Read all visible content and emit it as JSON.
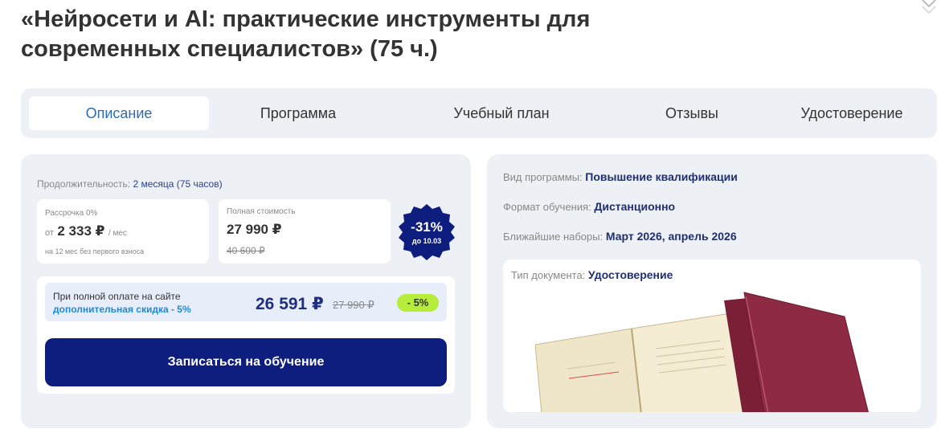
{
  "header": {
    "title_line1": "«Нейросети и AI: практические инструменты для",
    "title_line2": "современных специалистов» (75 ч.)"
  },
  "tabs": [
    {
      "label": "Описание",
      "active": true
    },
    {
      "label": "Программа",
      "active": false
    },
    {
      "label": "Учебный план",
      "active": false
    },
    {
      "label": "Отзывы",
      "active": false
    },
    {
      "label": "Удостоверение",
      "active": false
    }
  ],
  "pricing": {
    "duration_label": "Продолжительность:",
    "duration_value": "2 месяца (75 часов)",
    "installment": {
      "title": "Рассрочка 0%",
      "prefix": "от",
      "amount": "2 333 ₽",
      "suffix": "/ мес",
      "note": "на 12 мес без первого взноса"
    },
    "full_price": {
      "title": "Полная стоимость",
      "price": "27 990 ₽",
      "old_price": "40 600 ₽"
    },
    "discount_badge": {
      "percent": "-31%",
      "until": "до 10.03"
    },
    "promo": {
      "line1": "При полной оплате на сайте",
      "line2": "дополнительная скидка - 5%",
      "price": "26 591 ₽",
      "old_price": "27 990 ₽",
      "pill": "- 5%"
    },
    "cta_label": "Записаться на обучение"
  },
  "details": {
    "program_type_label": "Вид программы:",
    "program_type_value": "Повышение квалификации",
    "format_label": "Формат обучения:",
    "format_value": "Дистанционно",
    "enrollment_label": "Ближайшие наборы:",
    "enrollment_value": "Март 2026, апрель 2026",
    "document_label": "Тип документа:",
    "document_value": "Удостоверение"
  },
  "colors": {
    "accent_blue": "#2d6bb5",
    "navy": "#0e1e7e",
    "badge": "#0e1e7e",
    "lime": "#b6ec3a",
    "panel_bg": "#edf0f5"
  }
}
